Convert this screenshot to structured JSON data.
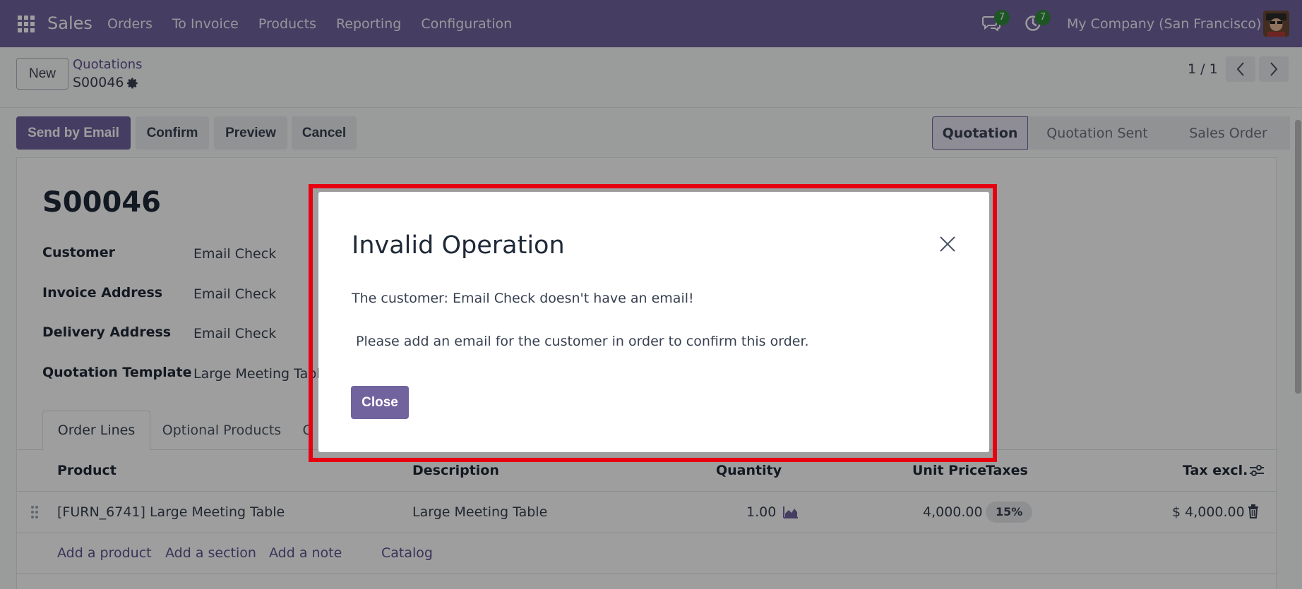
{
  "topbar": {
    "app_name": "Sales",
    "menu": [
      "Orders",
      "To Invoice",
      "Products",
      "Reporting",
      "Configuration"
    ],
    "messages_count": "7",
    "activities_count": "7",
    "company": "My Company (San Francisco)"
  },
  "control": {
    "new_label": "New",
    "breadcrumb_parent": "Quotations",
    "breadcrumb_current": "S00046",
    "pager": "1 / 1"
  },
  "actions": {
    "send_email": "Send by Email",
    "confirm": "Confirm",
    "preview": "Preview",
    "cancel": "Cancel"
  },
  "status": {
    "stages": [
      "Quotation",
      "Quotation Sent",
      "Sales Order"
    ],
    "active": "Quotation"
  },
  "form": {
    "title": "S00046",
    "fields": [
      {
        "label": "Customer",
        "value": "Email Check"
      },
      {
        "label": "Invoice Address",
        "value": "Email Check"
      },
      {
        "label": "Delivery Address",
        "value": "Email Check"
      },
      {
        "label": "Quotation Template",
        "value": "Large Meeting Table"
      }
    ],
    "tabs": [
      "Order Lines",
      "Optional Products",
      "O"
    ],
    "table": {
      "columns": [
        "Product",
        "Description",
        "Quantity",
        "Unit Price",
        "Taxes",
        "Tax excl."
      ],
      "row": {
        "product": "[FURN_6741] Large Meeting Table",
        "description": "Large Meeting Table",
        "quantity": "1.00",
        "unit_price": "4,000.00",
        "taxes": "15%",
        "subtotal": "$ 4,000.00"
      },
      "add_links": [
        "Add a product",
        "Add a section",
        "Add a note",
        "Catalog"
      ]
    }
  },
  "dialog": {
    "title": "Invalid Operation",
    "line1": "The customer: Email Check doesn't have an email!",
    "line2": " Please add an email for the customer in order to confirm this order.",
    "close_label": "Close"
  },
  "colors": {
    "brand": "#71639e",
    "highlight": "#e60012",
    "badge": "#2f8b3a"
  }
}
